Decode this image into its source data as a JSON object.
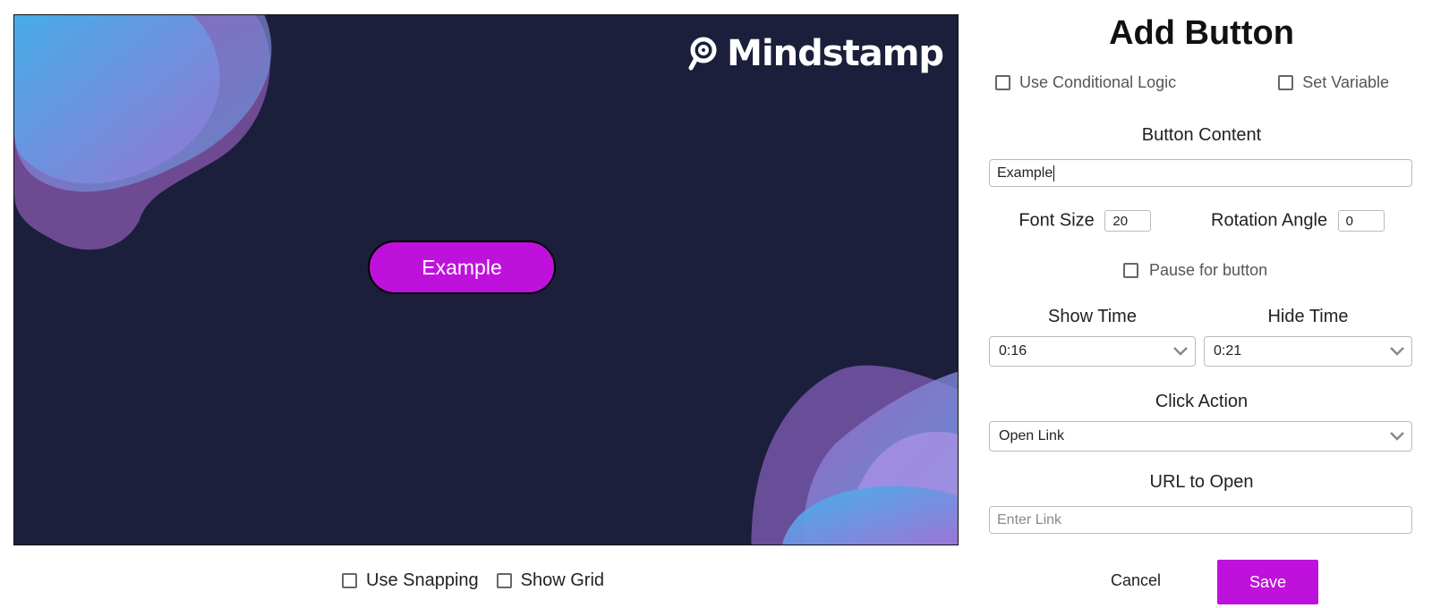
{
  "canvas": {
    "background_color": "#1b1f3b",
    "logo_text": "Mindstamp",
    "preview_button_label": "Example",
    "preview_button_color": "#bf11dc"
  },
  "canvas_options": {
    "use_snapping_label": "Use Snapping",
    "show_grid_label": "Show Grid"
  },
  "panel": {
    "title": "Add Button",
    "use_conditional_logic_label": "Use Conditional Logic",
    "set_variable_label": "Set Variable",
    "button_content_label": "Button Content",
    "button_content_value": "Example",
    "font_size_label": "Font Size",
    "font_size_value": "20",
    "rotation_angle_label": "Rotation Angle",
    "rotation_angle_value": "0",
    "pause_for_button_label": "Pause for button",
    "show_time_label": "Show Time",
    "show_time_value": "0:16",
    "hide_time_label": "Hide Time",
    "hide_time_value": "0:21",
    "click_action_label": "Click Action",
    "click_action_value": "Open Link",
    "url_label": "URL to Open",
    "url_placeholder": "Enter Link",
    "cancel_label": "Cancel",
    "save_label": "Save",
    "accent_color": "#bf11dc"
  }
}
